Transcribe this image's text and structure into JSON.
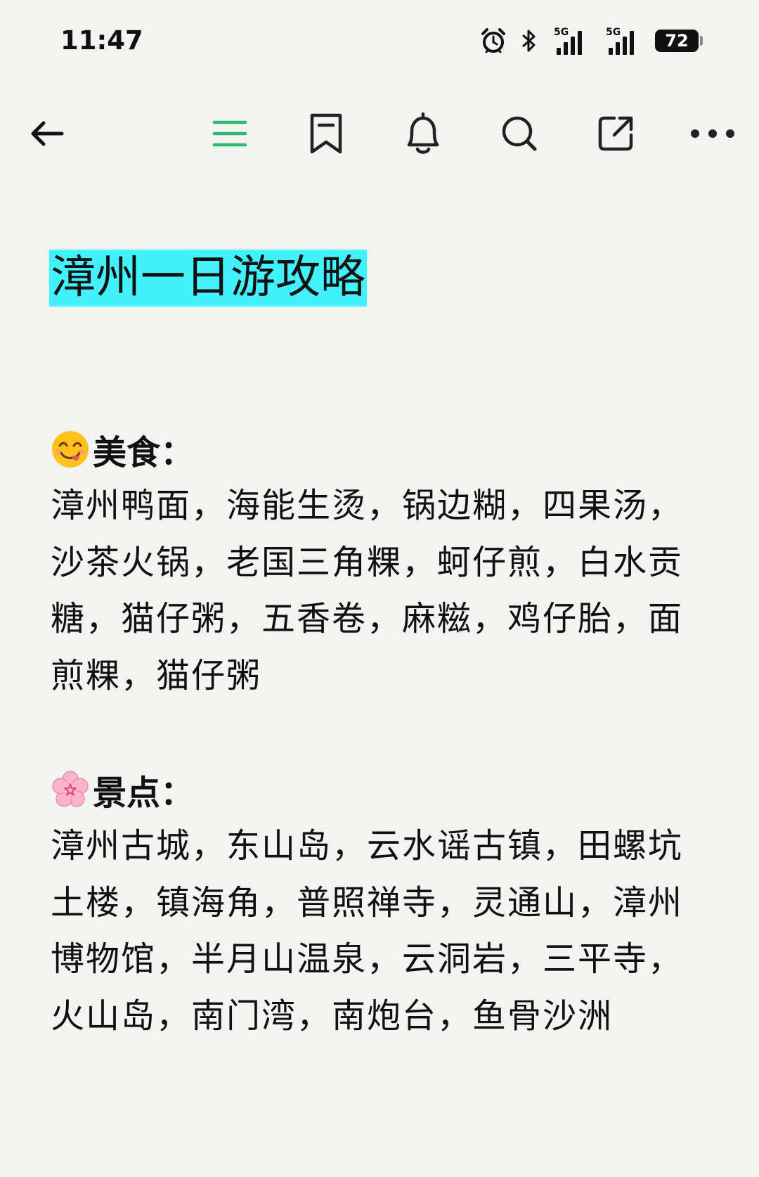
{
  "status_bar": {
    "time": "11:47",
    "signal_1_label": "5G",
    "signal_2_label": "5G",
    "battery": "72",
    "icons": [
      "alarm-icon",
      "bluetooth-icon",
      "signal-icon",
      "signal-icon",
      "battery-icon"
    ]
  },
  "toolbar": {
    "icons": [
      "back-arrow-icon",
      "menu-icon",
      "bookmark-icon",
      "bell-icon",
      "search-icon",
      "share-icon",
      "more-icon"
    ],
    "accent_color": "#2dbb6f"
  },
  "note": {
    "title": "漳州一日游攻略",
    "title_highlight_color": "#41f2fb",
    "sections": [
      {
        "emoji": "savoring-face-emoji",
        "heading": "美食：",
        "body": "漳州鸭面，海能生烫，锅边糊，四果汤，沙茶火锅，老国三角粿，蚵仔煎，白水贡糖，猫仔粥，五香卷，麻糍，鸡仔胎，面煎粿，猫仔粥"
      },
      {
        "emoji": "cherry-blossom-emoji",
        "heading": "景点：",
        "body": "漳州古城，东山岛，云水谣古镇，田螺坑土楼，镇海角，普照禅寺，灵通山，漳州博物馆，半月山温泉，云洞岩，三平寺，火山岛，南门湾，南炮台，鱼骨沙洲"
      }
    ]
  }
}
